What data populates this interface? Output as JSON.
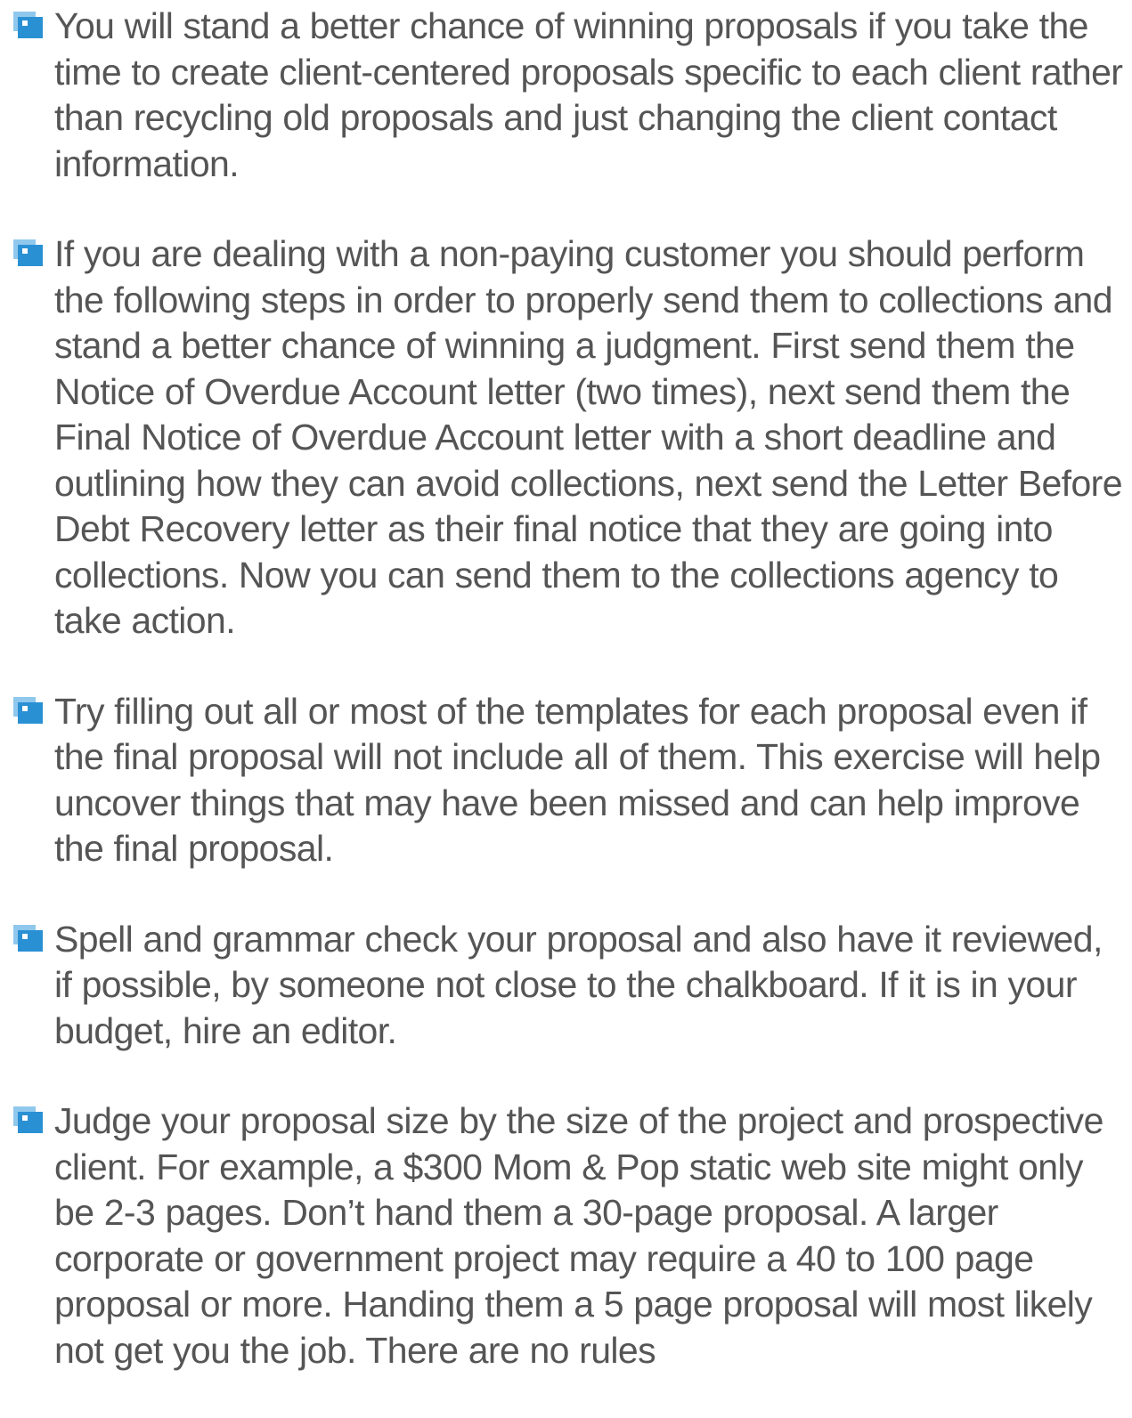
{
  "tips": [
    {
      "icon": "note-bullet-icon",
      "text": "You will stand a better chance of winning proposals if you take the time to create client-centered proposals specific to each client rather than recycling old proposals and just changing the client contact information."
    },
    {
      "icon": "note-bullet-icon",
      "text": "If you are dealing with a non-paying customer you should perform the following steps in order to properly send them to collections and stand a better chance of winning a judgment. First send them the Notice of Overdue Account letter (two times), next send them the Final Notice of Overdue Account letter with a short deadline and outlining how they can avoid collections, next send the Letter Before Debt Recovery letter as their final notice that they are going into collections.  Now you can send them to the collections agency to take action."
    },
    {
      "icon": "note-bullet-icon",
      "text": "Try filling out all or most of the templates for each proposal even if the final proposal will not include all of them. This exercise will help uncover things that may have been missed and can help improve the final proposal."
    },
    {
      "icon": "note-bullet-icon",
      "text": "Spell and grammar check your proposal and also have it reviewed, if possible, by someone not close to the chalkboard. If it is in your budget, hire an editor."
    },
    {
      "icon": "note-bullet-icon",
      "text": "Judge your proposal size by the size of the project and prospective client. For example, a $300 Mom & Pop static web site might only be 2-3 pages. Don’t hand them a 30-page proposal. A larger corporate or government project may require a 40 to 100 page proposal or more. Handing them a 5 page proposal will most likely not get you the job. There are no rules"
    }
  ],
  "colors": {
    "text": "#555555",
    "icon_back": "#8fc8ec",
    "icon_front": "#2a90d4",
    "icon_highlight": "#ffffff"
  }
}
